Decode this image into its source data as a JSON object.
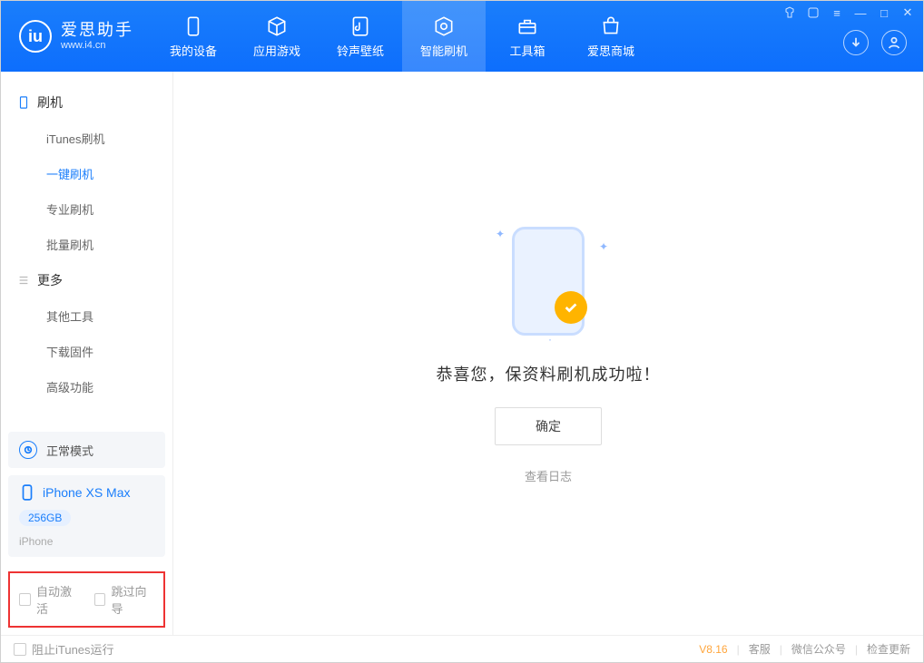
{
  "app": {
    "title": "爱思助手",
    "subtitle": "www.i4.cn"
  },
  "tabs": [
    {
      "label": "我的设备",
      "icon": "device"
    },
    {
      "label": "应用游戏",
      "icon": "cube"
    },
    {
      "label": "铃声壁纸",
      "icon": "music"
    },
    {
      "label": "智能刷机",
      "icon": "refresh",
      "active": true
    },
    {
      "label": "工具箱",
      "icon": "toolbox"
    },
    {
      "label": "爱思商城",
      "icon": "shop"
    }
  ],
  "sidebar": {
    "group1_title": "刷机",
    "group1_items": [
      "iTunes刷机",
      "一键刷机",
      "专业刷机",
      "批量刷机"
    ],
    "group1_active_index": 1,
    "group2_title": "更多",
    "group2_items": [
      "其他工具",
      "下载固件",
      "高级功能"
    ]
  },
  "device_panel": {
    "mode_label": "正常模式",
    "device_name": "iPhone XS Max",
    "capacity": "256GB",
    "device_type": "iPhone"
  },
  "checkbox_row": {
    "auto_activate": "自动激活",
    "skip_guide": "跳过向导"
  },
  "main": {
    "success_text": "恭喜您，保资料刷机成功啦！",
    "ok_button": "确定",
    "log_link": "查看日志"
  },
  "footer": {
    "block_itunes": "阻止iTunes运行",
    "version": "V8.16",
    "links": [
      "客服",
      "微信公众号",
      "检查更新"
    ]
  }
}
